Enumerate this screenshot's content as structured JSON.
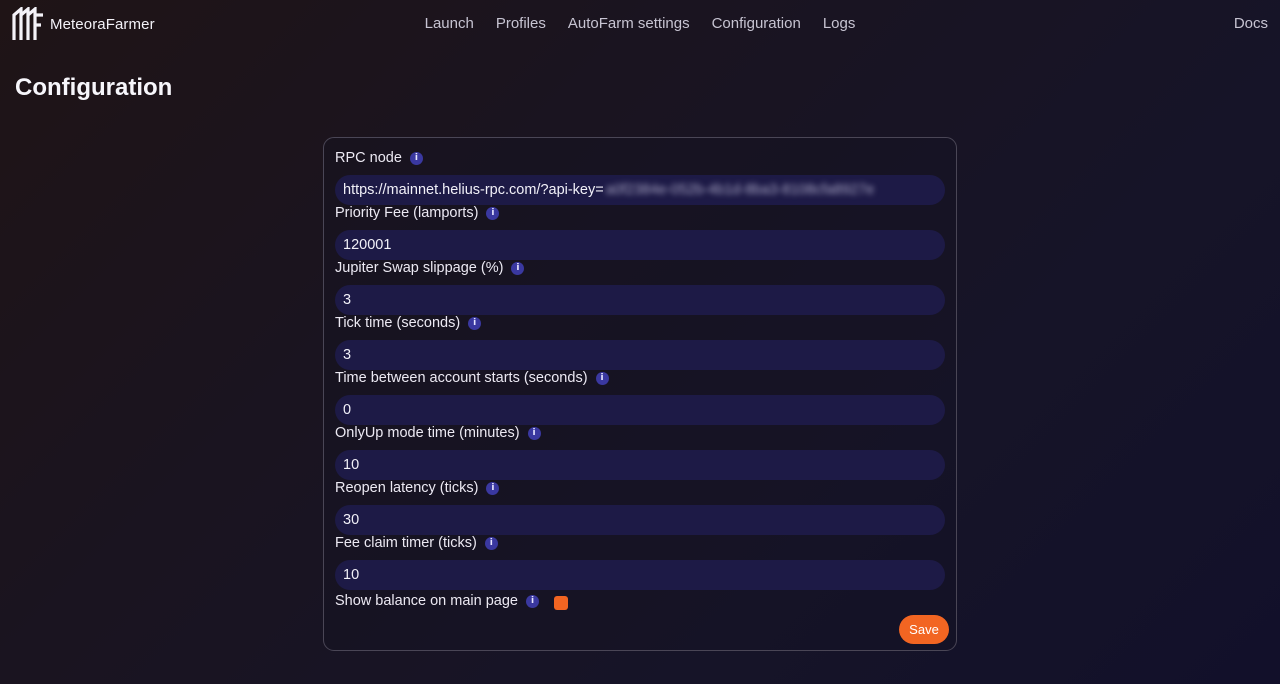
{
  "brand": {
    "name": "MeteoraFarmer",
    "logo_icon": "mf-logo-icon"
  },
  "nav": {
    "links": [
      "Launch",
      "Profiles",
      "AutoFarm settings",
      "Configuration",
      "Logs"
    ],
    "docs": "Docs"
  },
  "page": {
    "title": "Configuration"
  },
  "form": {
    "fields": [
      {
        "label": "RPC node",
        "value": "https://mainnet.helius-rpc.com/?api-key=",
        "value_redacted": "a0f2384e-052b-4b1d-8ba3-8108cfa8927e"
      },
      {
        "label": "Priority Fee (lamports)",
        "value": "120001"
      },
      {
        "label": "Jupiter Swap slippage (%)",
        "value": "3"
      },
      {
        "label": "Tick time (seconds)",
        "value": "3"
      },
      {
        "label": "Time between account starts (seconds)",
        "value": "0"
      },
      {
        "label": "OnlyUp mode time (minutes)",
        "value": "10"
      },
      {
        "label": "Reopen latency (ticks)",
        "value": "30"
      },
      {
        "label": "Fee claim timer (ticks)",
        "value": "10"
      }
    ],
    "checkbox": {
      "label": "Show balance on main page",
      "checked": true
    },
    "info_icon_glyph": "i",
    "save_label": "Save"
  },
  "colors": {
    "accent": "#f26522",
    "input_bg": "#1d1a46",
    "info_icon": "#3a38a0"
  }
}
